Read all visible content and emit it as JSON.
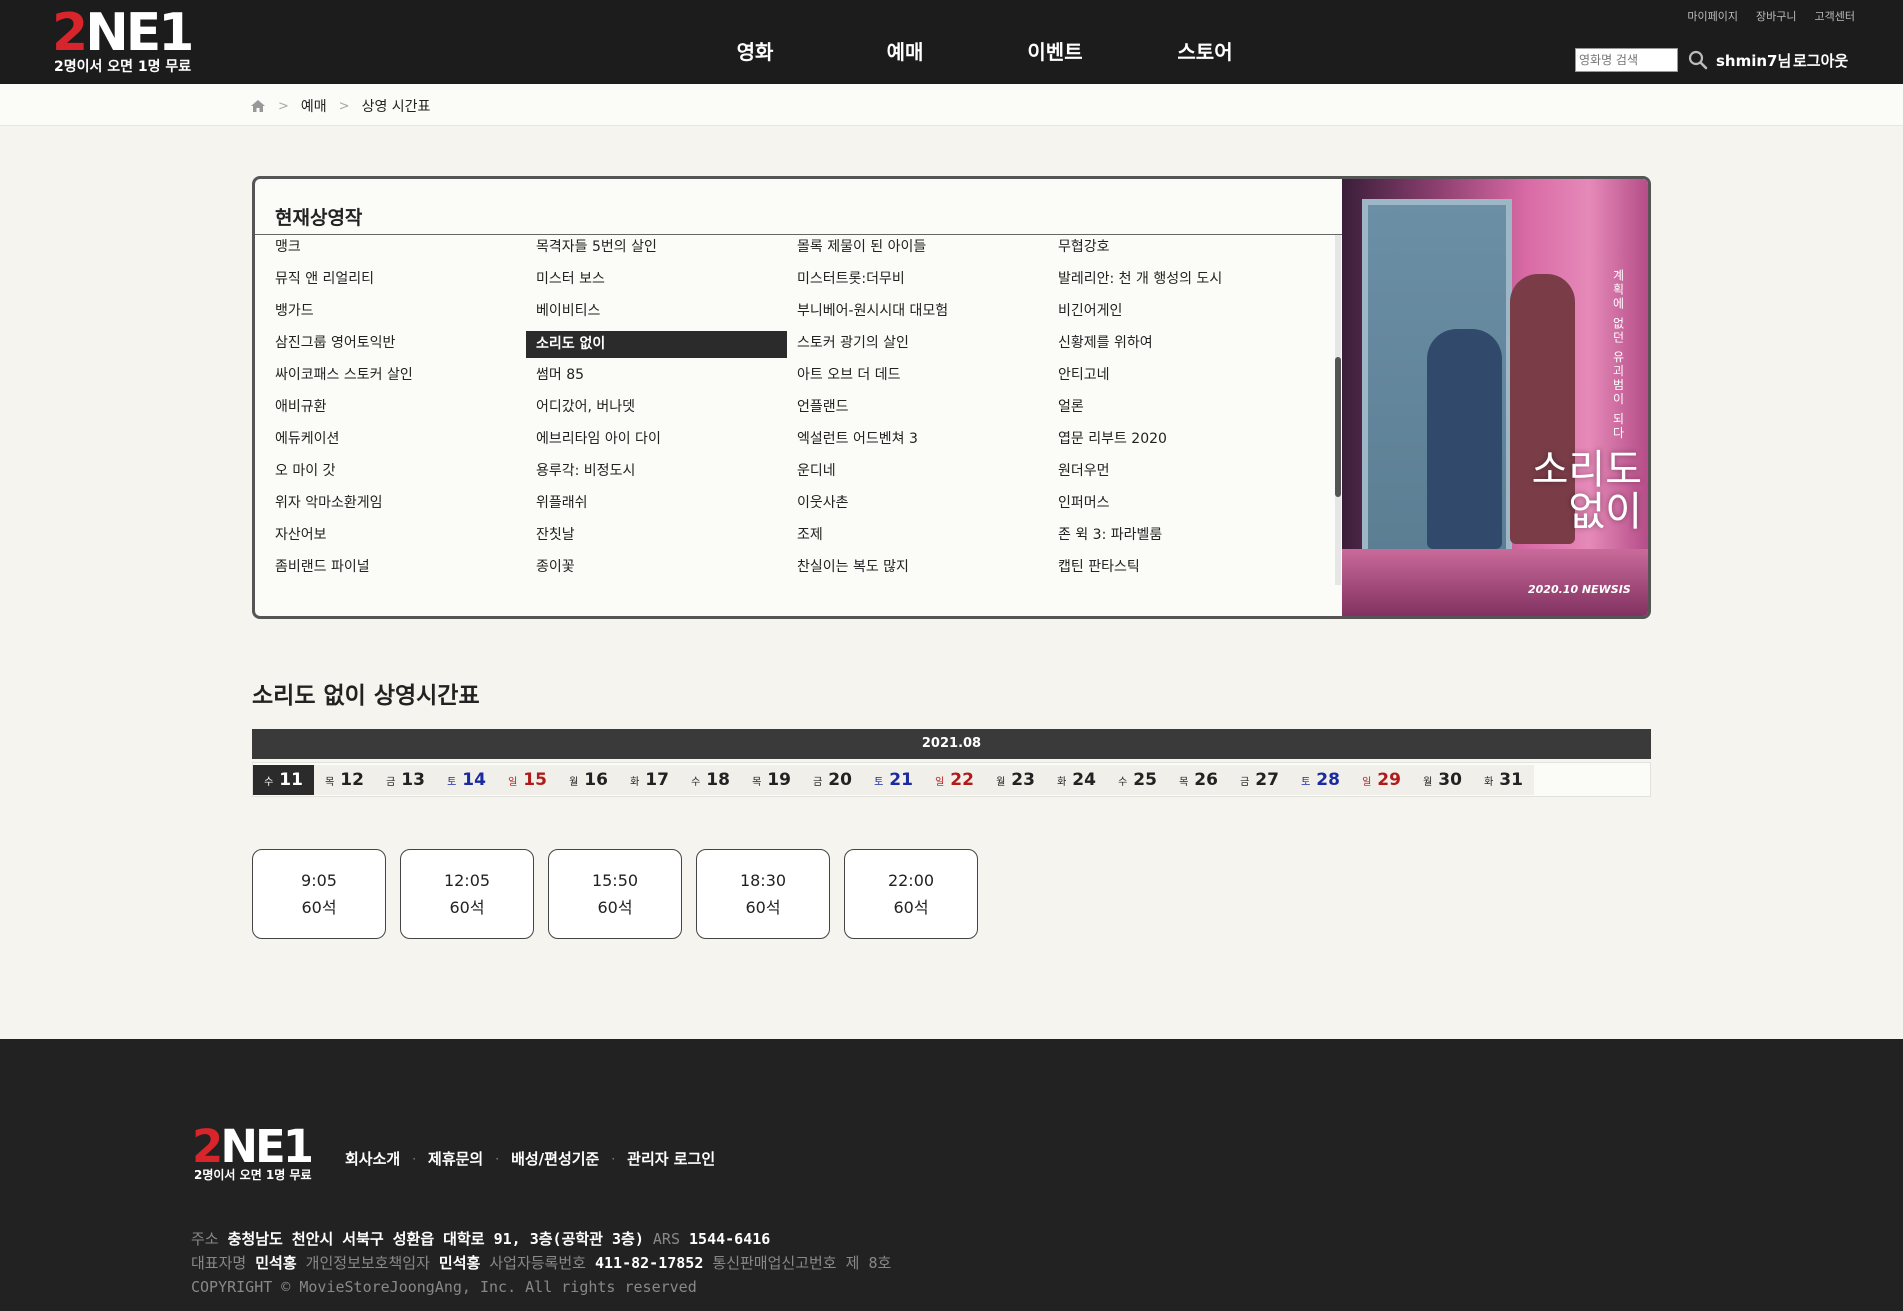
{
  "header": {
    "logo_main_red": "2",
    "logo_main_white": "NE1",
    "logo_sub": "2명이서 오면 1명 무료",
    "nav": [
      "영화",
      "예매",
      "이벤트",
      "스토어"
    ],
    "util": [
      "마이페이지",
      "장바구니",
      "고객센터"
    ],
    "search_placeholder": "영화명 검색",
    "user_name": "shmin7님",
    "logout_label": "로그아웃"
  },
  "breadcrumb": {
    "items": [
      "예매",
      "상영 시간표"
    ],
    "separator": ">"
  },
  "current": {
    "title": "현재상영작",
    "movies": [
      "맹크",
      "목격자들 5번의 살인",
      "몰록 제물이 된 아이들",
      "무협강호",
      "뮤직 앤 리얼리티",
      "미스터 보스",
      "미스터트롯:더무비",
      "발레리안: 천 개 행성의 도시",
      "뱅가드",
      "베이비티스",
      "부니베어-원시시대 대모험",
      "비긴어게인",
      "삼진그룹 영어토익반",
      "소리도 없이",
      "스토커 광기의 살인",
      "신황제를 위하여",
      "싸이코패스 스토커 살인",
      "썸머 85",
      "아트 오브 더 데드",
      "안티고네",
      "애비규환",
      "어디갔어, 버나뎃",
      "언플랜드",
      "얼론",
      "에듀케이션",
      "에브리타임 아이 다이",
      "엑설런트 어드벤쳐 3",
      "엽문 리부트 2020",
      "오 마이 갓",
      "용루각: 비정도시",
      "운디네",
      "원더우먼",
      "위자 악마소환게임",
      "위플래쉬",
      "이웃사촌",
      "인퍼머스",
      "자산어보",
      "잔칫날",
      "조제",
      "존 윅 3: 파라벨룸",
      "좀비랜드 파이널",
      "종이꽃",
      "찬실이는 복도 많지",
      "캡틴 판타스틱"
    ],
    "selected_index": 13,
    "poster": {
      "title": "소리도 없이",
      "tagline": "계획에 없던 유괴범이 되다",
      "credit": "2020.10 NEWSIS"
    }
  },
  "schedule": {
    "title": "소리도 없이 상영시간표",
    "month": "2021.08",
    "dates": [
      {
        "dow": "수",
        "day": "11",
        "type": "weekday"
      },
      {
        "dow": "목",
        "day": "12",
        "type": "weekday"
      },
      {
        "dow": "금",
        "day": "13",
        "type": "weekday"
      },
      {
        "dow": "토",
        "day": "14",
        "type": "sat"
      },
      {
        "dow": "일",
        "day": "15",
        "type": "sun"
      },
      {
        "dow": "월",
        "day": "16",
        "type": "weekday"
      },
      {
        "dow": "화",
        "day": "17",
        "type": "weekday"
      },
      {
        "dow": "수",
        "day": "18",
        "type": "weekday"
      },
      {
        "dow": "목",
        "day": "19",
        "type": "weekday"
      },
      {
        "dow": "금",
        "day": "20",
        "type": "weekday"
      },
      {
        "dow": "토",
        "day": "21",
        "type": "sat"
      },
      {
        "dow": "일",
        "day": "22",
        "type": "sun"
      },
      {
        "dow": "월",
        "day": "23",
        "type": "weekday"
      },
      {
        "dow": "화",
        "day": "24",
        "type": "weekday"
      },
      {
        "dow": "수",
        "day": "25",
        "type": "weekday"
      },
      {
        "dow": "목",
        "day": "26",
        "type": "weekday"
      },
      {
        "dow": "금",
        "day": "27",
        "type": "weekday"
      },
      {
        "dow": "토",
        "day": "28",
        "type": "sat"
      },
      {
        "dow": "일",
        "day": "29",
        "type": "sun"
      },
      {
        "dow": "월",
        "day": "30",
        "type": "weekday"
      },
      {
        "dow": "화",
        "day": "31",
        "type": "weekday"
      }
    ],
    "active_date_index": 0,
    "times": [
      {
        "time": "9:05",
        "seats": "60석"
      },
      {
        "time": "12:05",
        "seats": "60석"
      },
      {
        "time": "15:50",
        "seats": "60석"
      },
      {
        "time": "18:30",
        "seats": "60석"
      },
      {
        "time": "22:00",
        "seats": "60석"
      }
    ]
  },
  "footer": {
    "links": [
      "회사소개",
      "제휴문의",
      "배성/편성기준",
      "관리자 로그인"
    ],
    "address_label": "주소",
    "address": "충청남도 천안시 서북구 성환읍 대학로 91, 3층(공학관 3층)",
    "ars_label": "ARS",
    "ars": "1544-6416",
    "ceo_label": "대표자명",
    "ceo": "민석홍",
    "privacy_label": "개인정보보호책임자",
    "privacy": "민석홍",
    "biz_label": "사업자등록번호",
    "biz": "411-82-17852",
    "mail_order": "통신판매업신고번호 제 8호",
    "copyright": "COPYRIGHT © MovieStoreJoongAng, Inc. All rights reserved"
  },
  "colors": {
    "header_bg": "#1c1c1c",
    "logo_red": "#d8252c",
    "page_bg": "#f5f4ef",
    "saturday": "#1a2aa0",
    "sunday": "#b01a1a",
    "selected_bg": "#2b2b2b"
  }
}
